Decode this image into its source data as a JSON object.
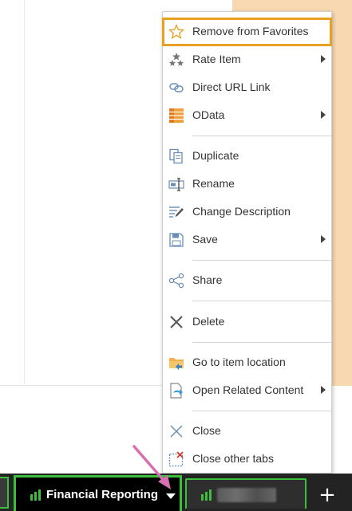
{
  "menu": {
    "items": [
      {
        "label": "Remove from Favorites",
        "icon": "star-outline-icon",
        "submenu": false,
        "highlighted": true
      },
      {
        "label": "Rate Item",
        "icon": "rating-stars-icon",
        "submenu": true
      },
      {
        "label": "Direct URL Link",
        "icon": "link-icon",
        "submenu": false
      },
      {
        "label": "OData",
        "icon": "odata-icon",
        "submenu": true
      },
      {
        "label": "Duplicate",
        "icon": "duplicate-icon",
        "submenu": false
      },
      {
        "label": "Rename",
        "icon": "rename-icon",
        "submenu": false
      },
      {
        "label": "Change Description",
        "icon": "edit-description-icon",
        "submenu": false
      },
      {
        "label": "Save",
        "icon": "save-icon",
        "submenu": true
      },
      {
        "label": "Share",
        "icon": "share-icon",
        "submenu": false
      },
      {
        "label": "Delete",
        "icon": "delete-x-icon",
        "submenu": false
      },
      {
        "label": "Go to item location",
        "icon": "folder-location-icon",
        "submenu": false
      },
      {
        "label": "Open Related Content",
        "icon": "related-content-icon",
        "submenu": true
      },
      {
        "label": "Close",
        "icon": "close-icon",
        "submenu": false
      },
      {
        "label": "Close other tabs",
        "icon": "close-other-tabs-icon",
        "submenu": false
      }
    ]
  },
  "tabs": {
    "active_title": "Financial Reporting",
    "add_label": "+"
  },
  "colors": {
    "highlight": "#e8a020",
    "tab_border": "#3cbf3c",
    "chart_icon": "#3cbf3c",
    "peach_panel": "#f8d8b0",
    "annotation_arrow": "#d670b0"
  }
}
